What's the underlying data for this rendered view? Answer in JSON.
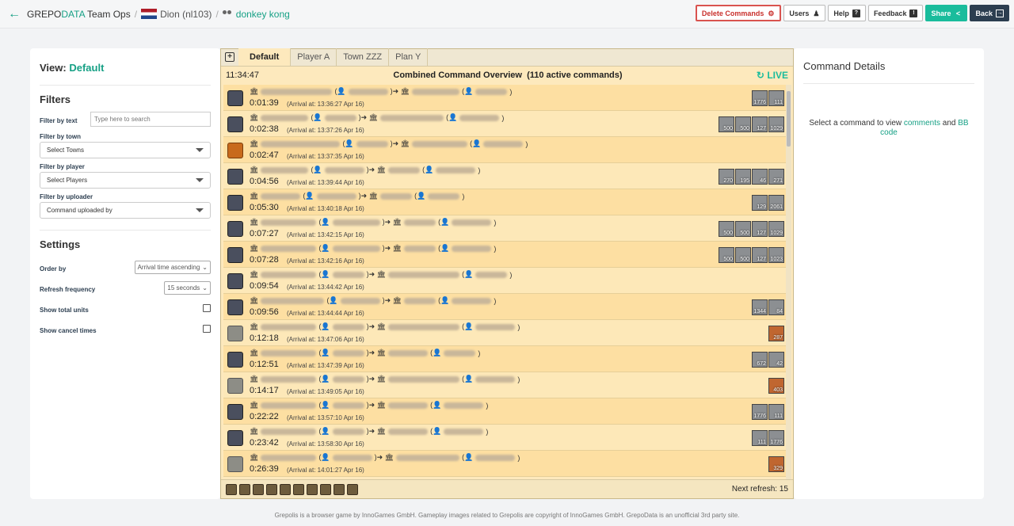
{
  "topbar": {
    "brand_prefix": "GREPO",
    "brand_accent": "DATA",
    "brand_suffix": " Team Ops",
    "world": "Dion (nl103)",
    "team": "donkey kong",
    "buttons": {
      "delete": "Delete Commands",
      "users": "Users",
      "help": "Help",
      "feedback": "Feedback",
      "share": "Share",
      "back": "Back"
    }
  },
  "left": {
    "view_label": "View:",
    "view_name": "Default",
    "filters_title": "Filters",
    "filter_text_label": "Filter by text",
    "filter_text_placeholder": "Type here to search",
    "filter_town_label": "Filter by town",
    "filter_town_value": "Select Towns",
    "filter_player_label": "Filter by player",
    "filter_player_value": "Select Players",
    "filter_uploader_label": "Filter by uploader",
    "filter_uploader_value": "Command uploaded by",
    "settings_title": "Settings",
    "order_label": "Order by",
    "order_value": "Arrival time ascending",
    "refresh_label": "Refresh frequency",
    "refresh_value": "15 seconds",
    "total_units_label": "Show total units",
    "cancel_times_label": "Show cancel times"
  },
  "center": {
    "tabs": [
      "Default",
      "Player A",
      "Town ZZZ",
      "Plan Y"
    ],
    "clock": "11:34:47",
    "overview_title": "Combined Command Overview",
    "active_count": "(110 active commands)",
    "live_label": "LIVE",
    "next_refresh": "Next refresh: 15",
    "commands": [
      {
        "type": "attack",
        "time": "0:01:39",
        "arrival": "(Arrival at: 13:36:27 Apr 16)",
        "units": [
          "1776",
          "111"
        ]
      },
      {
        "type": "attack",
        "time": "0:02:38",
        "arrival": "(Arrival at: 13:37:26 Apr 16)",
        "units": [
          "500",
          "500",
          "127",
          "1029"
        ]
      },
      {
        "type": "support",
        "time": "0:02:47",
        "arrival": "(Arrival at: 13:37:35 Apr 16)",
        "units": []
      },
      {
        "type": "attack",
        "time": "0:04:56",
        "arrival": "(Arrival at: 13:39:44 Apr 16)",
        "units": [
          "270",
          "195",
          "46",
          "271"
        ]
      },
      {
        "type": "attack",
        "time": "0:05:30",
        "arrival": "(Arrival at: 13:40:18 Apr 16)",
        "units": [
          "129",
          "2061"
        ]
      },
      {
        "type": "attack",
        "time": "0:07:27",
        "arrival": "(Arrival at: 13:42:15 Apr 16)",
        "units": [
          "500",
          "500",
          "127",
          "1029"
        ]
      },
      {
        "type": "attack",
        "time": "0:07:28",
        "arrival": "(Arrival at: 13:42:16 Apr 16)",
        "units": [
          "500",
          "500",
          "127",
          "1023"
        ]
      },
      {
        "type": "attack",
        "time": "0:09:54",
        "arrival": "(Arrival at: 13:44:42 Apr 16)",
        "units": []
      },
      {
        "type": "attack",
        "time": "0:09:56",
        "arrival": "(Arrival at: 13:44:44 Apr 16)",
        "units": [
          "1344",
          "84"
        ]
      },
      {
        "type": "spell",
        "time": "0:12:18",
        "arrival": "(Arrival at: 13:47:06 Apr 16)",
        "units": [
          "287"
        ]
      },
      {
        "type": "attack",
        "time": "0:12:51",
        "arrival": "(Arrival at: 13:47:39 Apr 16)",
        "units": [
          "672",
          "42"
        ]
      },
      {
        "type": "spell",
        "time": "0:14:17",
        "arrival": "(Arrival at: 13:49:05 Apr 16)",
        "units": [
          "403"
        ]
      },
      {
        "type": "attack",
        "time": "0:22:22",
        "arrival": "(Arrival at: 13:57:10 Apr 16)",
        "units": [
          "1776",
          "111"
        ]
      },
      {
        "type": "attack",
        "time": "0:23:42",
        "arrival": "(Arrival at: 13:58:30 Apr 16)",
        "units": [
          "111",
          "1776"
        ]
      },
      {
        "type": "spell",
        "time": "0:26:39",
        "arrival": "(Arrival at: 14:01:27 Apr 16)",
        "units": [
          "329"
        ]
      }
    ]
  },
  "details": {
    "title": "Command Details",
    "msg_pre": "Select a command to view ",
    "msg_comments": "comments",
    "msg_mid": " and ",
    "msg_bb": "BB code"
  },
  "footer": "Grepolis is a browser game by InnoGames GmbH. Gameplay images related to Grepolis are copyright of InnoGames GmbH. GrepoData is an unofficial 3rd party site."
}
